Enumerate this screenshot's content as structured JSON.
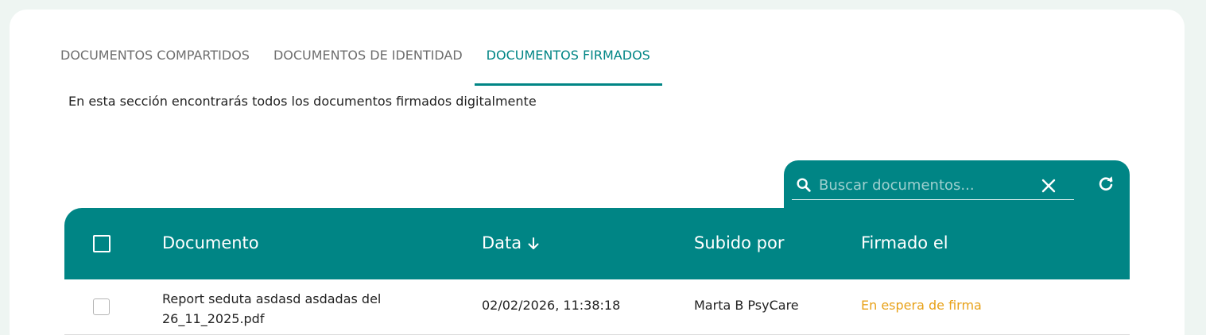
{
  "tabs": [
    {
      "label": "DOCUMENTOS COMPARTIDOS",
      "active": false
    },
    {
      "label": "DOCUMENTOS DE IDENTIDAD",
      "active": false
    },
    {
      "label": "DOCUMENTOS FIRMADOS",
      "active": true
    }
  ],
  "description": "En esta sección encontrarás todos los documentos firmados digitalmente",
  "search": {
    "placeholder": "Buscar documentos...",
    "value": ""
  },
  "table": {
    "columns": [
      "Documento",
      "Data",
      "Subido por",
      "Firmado el"
    ],
    "sort_column": "Data",
    "sort_direction": "desc",
    "rows": [
      {
        "document": "Report seduta asdasd asdadas del 26_11_2025.pdf",
        "date": "02/02/2026, 11:38:18",
        "uploaded_by": "Marta B PsyCare",
        "signed_on": "En espera de firma"
      }
    ]
  },
  "colors": {
    "primary": "#008585",
    "background": "#eef5f2",
    "pending_status": "#e8a21a",
    "tab_inactive": "#6e6e6e"
  },
  "icons": {
    "search": "search-icon",
    "clear": "close-icon",
    "refresh": "refresh-icon",
    "sort": "arrow-down-icon"
  }
}
